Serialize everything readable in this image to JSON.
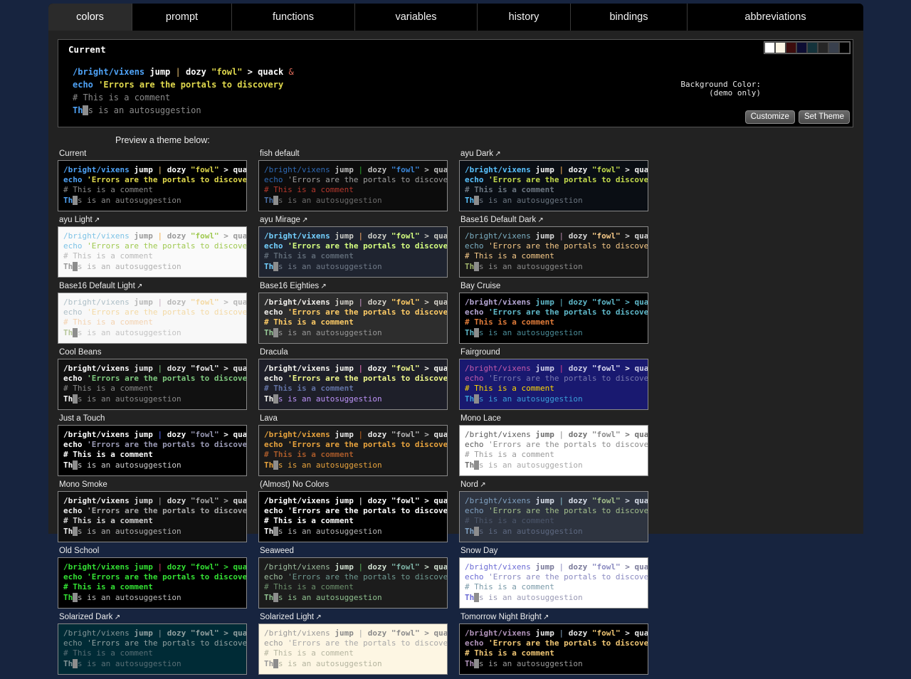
{
  "window": {
    "page_bg": "#17243f",
    "frame_bg": "#222222"
  },
  "tabs": [
    {
      "label": "colors",
      "active": true
    },
    {
      "label": "prompt",
      "active": false
    },
    {
      "label": "functions",
      "active": false
    },
    {
      "label": "variables",
      "active": false
    },
    {
      "label": "history",
      "active": false
    },
    {
      "label": "bindings",
      "active": false
    },
    {
      "label": "abbreviations",
      "active": false
    }
  ],
  "current": {
    "title": "Current",
    "background_color_label": "Background Color:\n      (demo only)",
    "swatches": [
      "#ffffff",
      "#faf4e3",
      "#3d0c0c",
      "#0d0d33",
      "#14333b",
      "#262626",
      "#39404d",
      "#000000"
    ],
    "customize_button": "Customize",
    "set_theme_button": "Set Theme"
  },
  "preview_heading": "Preview a theme below:",
  "sample": {
    "line1": {
      "cmd": "/bright/vixens",
      "arg1": " jump ",
      "pipe": "|",
      "arg2": " dozy ",
      "quote": "\"fowl\"",
      "redir": " > ",
      "cmd2": "quack",
      "amp": " &"
    },
    "line2": {
      "cmd": "echo",
      "str": " 'Errors are the portals to discovery"
    },
    "line3": "# This is a comment",
    "line4": {
      "pre": "Th",
      "cursor": "i",
      "post": "s is an autosuggestion"
    }
  },
  "themes": [
    {
      "name": "Current",
      "external": false,
      "bg": "#000000",
      "border": "#888888",
      "cmd": "#4fa3f7",
      "arg": "#ffffff",
      "pipe": "#f0c674",
      "quote": "#e0d94d",
      "redir": "#ffffff",
      "amp": "#e06c5a",
      "str": "#e0d94d",
      "comment": "#8a8a8a",
      "autosuggest": "#8a8a8a",
      "autopre": "#4fa3f7",
      "cmdbold": true
    },
    {
      "name": "fish default",
      "external": false,
      "bg": "#0c0c0c",
      "border": "#888888",
      "cmd": "#2f6ab5",
      "arg": "#bfbfbf",
      "pipe": "#2aa82a",
      "quote": "#3b86d8",
      "redir": "#bfbfbf",
      "amp": "#2aa82a",
      "str": "#9e9e9e",
      "comment": "#b4372c",
      "autosuggest": "#6b6b6b",
      "autopre": "#4a6fa5",
      "cmdbold": false
    },
    {
      "name": "ayu Dark",
      "external": true,
      "bg": "#0a0e14",
      "border": "#888888",
      "cmd": "#59c2ff",
      "arg": "#f2f2f2",
      "pipe": "#ffb454",
      "quote": "#c2d94c",
      "redir": "#f2f2f2",
      "amp": "#f07178",
      "str": "#c2d94c",
      "comment": "#6b7580",
      "autosuggest": "#6b7580",
      "autopre": "#59c2ff",
      "cmdbold": true
    },
    {
      "name": "ayu Light",
      "external": true,
      "bg": "#fafafa",
      "border": "#888888",
      "cmd": "#7ec3e6",
      "arg": "#9a9a9a",
      "pipe": "#f2ae49",
      "quote": "#9fc94f",
      "redir": "#9a9a9a",
      "amp": "#ef8e8e",
      "str": "#9fc94f",
      "comment": "#b9b9b9",
      "autosuggest": "#b0b0b0",
      "autopre": "#9a9a9a",
      "cmdbold": false
    },
    {
      "name": "ayu Mirage",
      "external": true,
      "bg": "#1f2430",
      "border": "#888888",
      "cmd": "#73d0ff",
      "arg": "#cbccc6",
      "pipe": "#ffad66",
      "quote": "#d5ff80",
      "redir": "#cbccc6",
      "amp": "#f28779",
      "str": "#d5ff80",
      "comment": "#5c6773",
      "autosuggest": "#707a88",
      "autopre": "#73d0ff",
      "cmdbold": true
    },
    {
      "name": "Base16 Default Dark",
      "external": true,
      "bg": "#181818",
      "border": "#888888",
      "cmd": "#7cafc2",
      "arg": "#d8d8d8",
      "pipe": "#ba8baf",
      "quote": "#f7ca88",
      "redir": "#d8d8d8",
      "amp": "#ab4642",
      "str": "#f7ca88",
      "comment": "#f7ca88",
      "autosuggest": "#8a8a8a",
      "autopre": "#a1b56c",
      "cmdbold": false
    },
    {
      "name": "Base16 Default Light",
      "external": true,
      "bg": "#f8f8f8",
      "border": "#888888",
      "cmd": "#aebfc7",
      "arg": "#b8b8b8",
      "pipe": "#cbb0c4",
      "quote": "#f3d9a4",
      "redir": "#b8b8b8",
      "amp": "#d49a98",
      "str": "#f3d9a4",
      "comment": "#f3d2b0",
      "autosuggest": "#c4c4c4",
      "autopre": "#b8c79b",
      "cmdbold": false
    },
    {
      "name": "Base16 Eighties",
      "external": true,
      "bg": "#2d2d2d",
      "border": "#888888",
      "cmd": "#f2f0ec",
      "arg": "#d3d0c8",
      "pipe": "#cc99cc",
      "quote": "#ffcc66",
      "redir": "#d3d0c8",
      "amp": "#f2777a",
      "str": "#ffcc66",
      "comment": "#ffcc66",
      "autosuggest": "#969696",
      "autopre": "#99cc99",
      "cmdbold": true
    },
    {
      "name": "Bay Cruise",
      "external": false,
      "bg": "#000000",
      "border": "#888888",
      "cmd": "#b5a6d4",
      "arg": "#5fb8c9",
      "pipe": "#5fb8c9",
      "quote": "#5fb8c9",
      "redir": "#5fb8c9",
      "amp": "#d4956b",
      "str": "#5fb8c9",
      "comment": "#e07b39",
      "autosuggest": "#4a8a96",
      "autopre": "#5fb8c9",
      "cmdbold": true
    },
    {
      "name": "Cool Beans",
      "external": false,
      "bg": "#111111",
      "border": "#888888",
      "cmd": "#ffffff",
      "arg": "#e8e8e8",
      "pipe": "#7ec97e",
      "quote": "#e8e8e8",
      "redir": "#e8e8e8",
      "amp": "#7ec97e",
      "str": "#7ec97e",
      "comment": "#8a8a8a",
      "autosuggest": "#8a8a8a",
      "autopre": "#ffffff",
      "cmdbold": true
    },
    {
      "name": "Dracula",
      "external": false,
      "bg": "#1e1f29",
      "border": "#888888",
      "cmd": "#f8f8f2",
      "arg": "#f8f8f2",
      "pipe": "#ff79c6",
      "quote": "#f1fa8c",
      "redir": "#f8f8f2",
      "amp": "#50fa7b",
      "str": "#f1fa8c",
      "comment": "#6272a4",
      "autosuggest": "#bd93f9",
      "autopre": "#f8f8f2",
      "cmdbold": true
    },
    {
      "name": "Fairground",
      "external": false,
      "bg": "#191970",
      "border": "#888888",
      "cmd": "#c45aab",
      "arg": "#cfcfe8",
      "pipe": "#e0408a",
      "quote": "#d8d8f0",
      "redir": "#ffffff",
      "amp": "#e0408a",
      "str": "#7b7bb0",
      "comment": "#ffd700",
      "autosuggest": "#3b9fd8",
      "autopre": "#3b9fd8",
      "cmdbold": false
    },
    {
      "name": "Just a Touch",
      "external": false,
      "bg": "#000000",
      "border": "#888888",
      "cmd": "#ffffff",
      "arg": "#ffffff",
      "pipe": "#5c6bff",
      "quote": "#9a9ab5",
      "redir": "#ffffff",
      "amp": "#ffffff",
      "str": "#9a9ab5",
      "comment": "#ffffff",
      "autosuggest": "#cfcfcf",
      "autopre": "#ffffff",
      "cmdbold": true
    },
    {
      "name": "Lava",
      "external": false,
      "bg": "#1a1a1a",
      "border": "#888888",
      "cmd": "#e8a33d",
      "arg": "#e8e8e8",
      "pipe": "#c96a1f",
      "quote": "#b5b5b5",
      "redir": "#b5b5b5",
      "amp": "#e8763d",
      "str": "#e8a33d",
      "comment": "#a85a2a",
      "autosuggest": "#e8a33d",
      "autopre": "#e8a33d",
      "cmdbold": true
    },
    {
      "name": "Mono Lace",
      "external": false,
      "bg": "#ffffff",
      "border": "#888888",
      "cmd": "#5a5a5a",
      "arg": "#6e6e6e",
      "pipe": "#8a8a8a",
      "quote": "#8a8a8a",
      "redir": "#6e6e6e",
      "amp": "#8a8a8a",
      "str": "#8a8a8a",
      "comment": "#9a9a9a",
      "autosuggest": "#a8a8a8",
      "autopre": "#6e6e6e",
      "cmdbold": false
    },
    {
      "name": "Mono Smoke",
      "external": false,
      "bg": "#0f0f0f",
      "border": "#888888",
      "cmd": "#f0f0f0",
      "arg": "#d8d8d8",
      "pipe": "#a0a0a0",
      "quote": "#a8a8a8",
      "redir": "#a8a8a8",
      "amp": "#a8a8a8",
      "str": "#a8a8a8",
      "comment": "#d0d0d0",
      "autosuggest": "#b0b0b0",
      "autopre": "#f0f0f0",
      "cmdbold": true
    },
    {
      "name": "(Almost) No Colors",
      "external": false,
      "bg": "#000000",
      "border": "#888888",
      "cmd": "#ffffff",
      "arg": "#ffffff",
      "pipe": "#ffffff",
      "quote": "#ffffff",
      "redir": "#ffffff",
      "amp": "#ffffff",
      "str": "#ffffff",
      "comment": "#ffffff",
      "autosuggest": "#b5b5b5",
      "autopre": "#ffffff",
      "cmdbold": true
    },
    {
      "name": "Nord",
      "external": true,
      "bg": "#2e3440",
      "border": "#888888",
      "cmd": "#81a1c1",
      "arg": "#d8dee9",
      "pipe": "#88c0d0",
      "quote": "#a3be8c",
      "redir": "#d8dee9",
      "amp": "#88c0d0",
      "str": "#a3be8c",
      "comment": "#4c566a",
      "autosuggest": "#5d6880",
      "autopre": "#81a1c1",
      "cmdbold": false
    },
    {
      "name": "Old School",
      "external": false,
      "bg": "#000000",
      "border": "#888888",
      "cmd": "#33e033",
      "arg": "#33e033",
      "pipe": "#e0406a",
      "quote": "#33e033",
      "redir": "#33e033",
      "amp": "#e0406a",
      "str": "#33e033",
      "comment": "#33e033",
      "autosuggest": "#bdbdbd",
      "autopre": "#33e033",
      "cmdbold": true
    },
    {
      "name": "Seaweed",
      "external": false,
      "bg": "#1c1c1c",
      "border": "#888888",
      "cmd": "#9fbfa0",
      "arg": "#d0e0d0",
      "pipe": "#5ab85a",
      "quote": "#7fb5a8",
      "redir": "#d0e0d0",
      "amp": "#5ab85a",
      "str": "#6f9a91",
      "comment": "#6b8f6b",
      "autosuggest": "#8fc08f",
      "autopre": "#8fc08f",
      "cmdbold": false
    },
    {
      "name": "Snow Day",
      "external": false,
      "bg": "#ffffff",
      "border": "#888888",
      "cmd": "#6b6bd4",
      "arg": "#7a7a9a",
      "pipe": "#8a8ac0",
      "quote": "#8a8ac0",
      "redir": "#7a7a9a",
      "amp": "#8a8ac0",
      "str": "#8a8ac0",
      "comment": "#7a9aa8",
      "autosuggest": "#9a9ab5",
      "autopre": "#6b6bd4",
      "cmdbold": false
    },
    {
      "name": "Solarized Dark",
      "external": true,
      "bg": "#002b36",
      "border": "#888888",
      "cmd": "#839496",
      "arg": "#93a1a1",
      "pipe": "#839496",
      "quote": "#93a1a1",
      "redir": "#93a1a1",
      "amp": "#839496",
      "str": "#93a1a1",
      "comment": "#586e75",
      "autosuggest": "#586e75",
      "autopre": "#839496",
      "cmdbold": false
    },
    {
      "name": "Solarized Light",
      "external": true,
      "bg": "#fdf6e3",
      "border": "#888888",
      "cmd": "#9a9a9a",
      "arg": "#8a8a8a",
      "pipe": "#a8a8a8",
      "quote": "#8a8a8a",
      "redir": "#8a8a8a",
      "amp": "#a8a8a8",
      "str": "#a8a8a8",
      "comment": "#b5b5a0",
      "autosuggest": "#b5b5a0",
      "autopre": "#9a9a9a",
      "cmdbold": false
    },
    {
      "name": "Tomorrow Night Bright",
      "external": true,
      "bg": "#000000",
      "border": "#888888",
      "cmd": "#b294bb",
      "arg": "#eaeaea",
      "pipe": "#81a2be",
      "quote": "#f0c674",
      "redir": "#eaeaea",
      "amp": "#eaeaea",
      "str": "#f0c674",
      "comment": "#f0c674",
      "autosuggest": "#9a9a9a",
      "autopre": "#b294bb",
      "cmdbold": true
    }
  ]
}
